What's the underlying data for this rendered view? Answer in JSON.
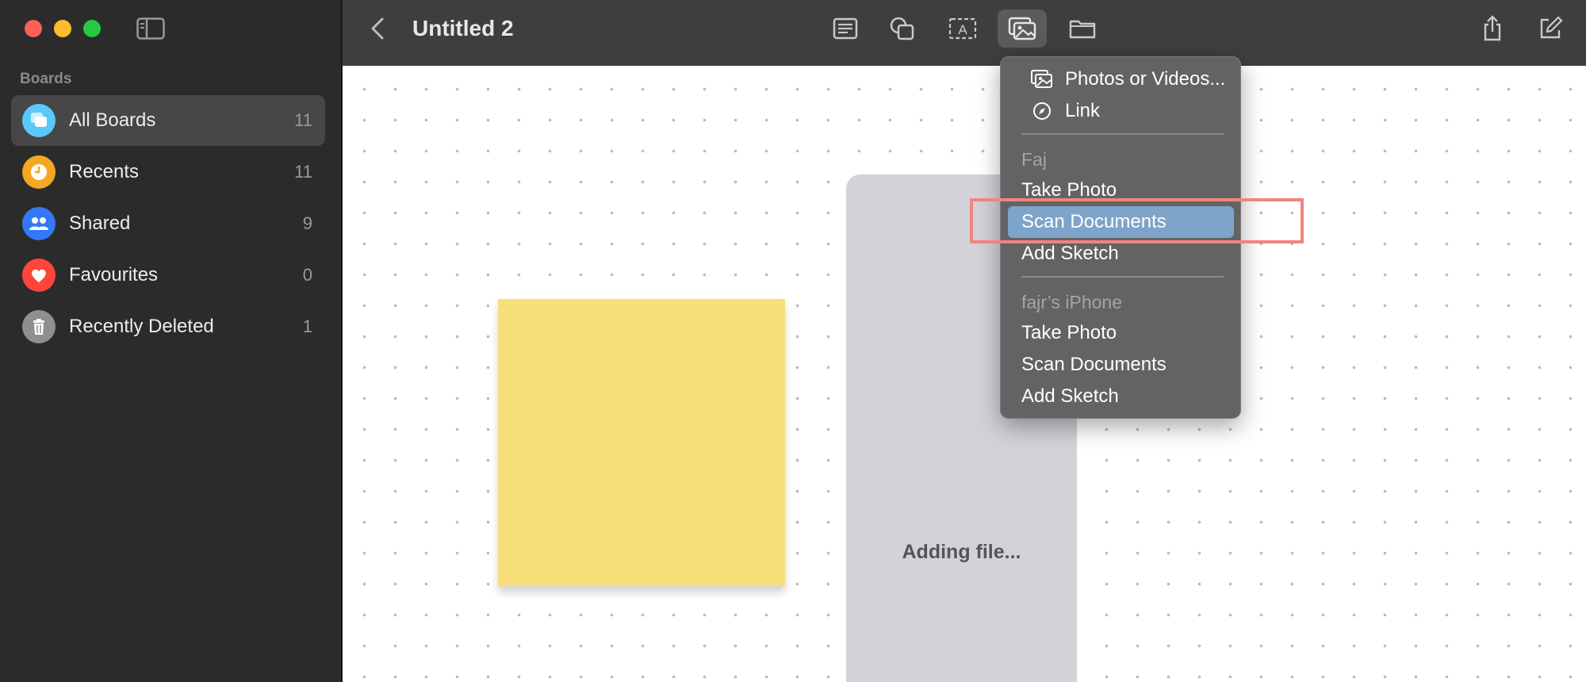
{
  "window": {
    "title": "Untitled 2",
    "traffic_lights": {
      "close": "#ff5f57",
      "minimize": "#febc2e",
      "maximize": "#28c840"
    }
  },
  "sidebar": {
    "section_title": "Boards",
    "items": [
      {
        "label": "All Boards",
        "count": "11",
        "icon": "boards-icon",
        "color": "#5ac8fa",
        "selected": true
      },
      {
        "label": "Recents",
        "count": "11",
        "icon": "clock-icon",
        "color": "#f5a623",
        "selected": false
      },
      {
        "label": "Shared",
        "count": "9",
        "icon": "people-icon",
        "color": "#3478f6",
        "selected": false
      },
      {
        "label": "Favourites",
        "count": "0",
        "icon": "heart-icon",
        "color": "#ff453a",
        "selected": false
      },
      {
        "label": "Recently Deleted",
        "count": "1",
        "icon": "trash-icon",
        "color": "#8e8e93",
        "selected": false
      }
    ]
  },
  "toolbar": {
    "tools": [
      {
        "icon": "note-icon"
      },
      {
        "icon": "shapes-icon"
      },
      {
        "icon": "text-box-icon"
      },
      {
        "icon": "insert-media-icon",
        "active": true
      },
      {
        "icon": "folder-icon"
      }
    ],
    "right": [
      {
        "icon": "share-icon"
      },
      {
        "icon": "compose-icon"
      }
    ]
  },
  "canvas": {
    "sticky_color": "#f9df7b",
    "file_card_status": "Adding file..."
  },
  "menu": {
    "photos_videos": "Photos or Videos...",
    "link": "Link",
    "device1": {
      "name": "Faj",
      "take_photo": "Take Photo",
      "scan_documents": "Scan Documents",
      "add_sketch": "Add Sketch"
    },
    "device2": {
      "name": "fajr’s iPhone",
      "take_photo": "Take Photo",
      "scan_documents": "Scan Documents",
      "add_sketch": "Add Sketch"
    },
    "highlight_color": "#7ea4c9"
  },
  "annotation": {
    "color": "#ef8480"
  }
}
